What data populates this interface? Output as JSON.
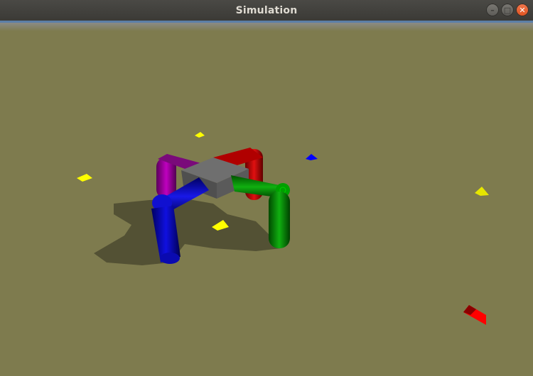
{
  "window": {
    "title": "Simulation",
    "controls": {
      "minimize_icon": "minimize-icon",
      "maximize_icon": "maximize-icon",
      "close_icon": "close-icon"
    }
  },
  "scene": {
    "ground_color": "#7e7b4e",
    "body_color": "#6f6f6f",
    "legs": [
      {
        "name": "red-leg",
        "color": "#d00000"
      },
      {
        "name": "purple-leg",
        "color": "#a000a0"
      },
      {
        "name": "blue-leg",
        "color": "#0000d0"
      },
      {
        "name": "green-leg",
        "color": "#00a000"
      }
    ],
    "markers": [
      {
        "name": "yellow-marker",
        "color": "#ffff00"
      },
      {
        "name": "blue-marker",
        "color": "#0000ff"
      },
      {
        "name": "red-marker",
        "color": "#ff0000"
      }
    ]
  }
}
